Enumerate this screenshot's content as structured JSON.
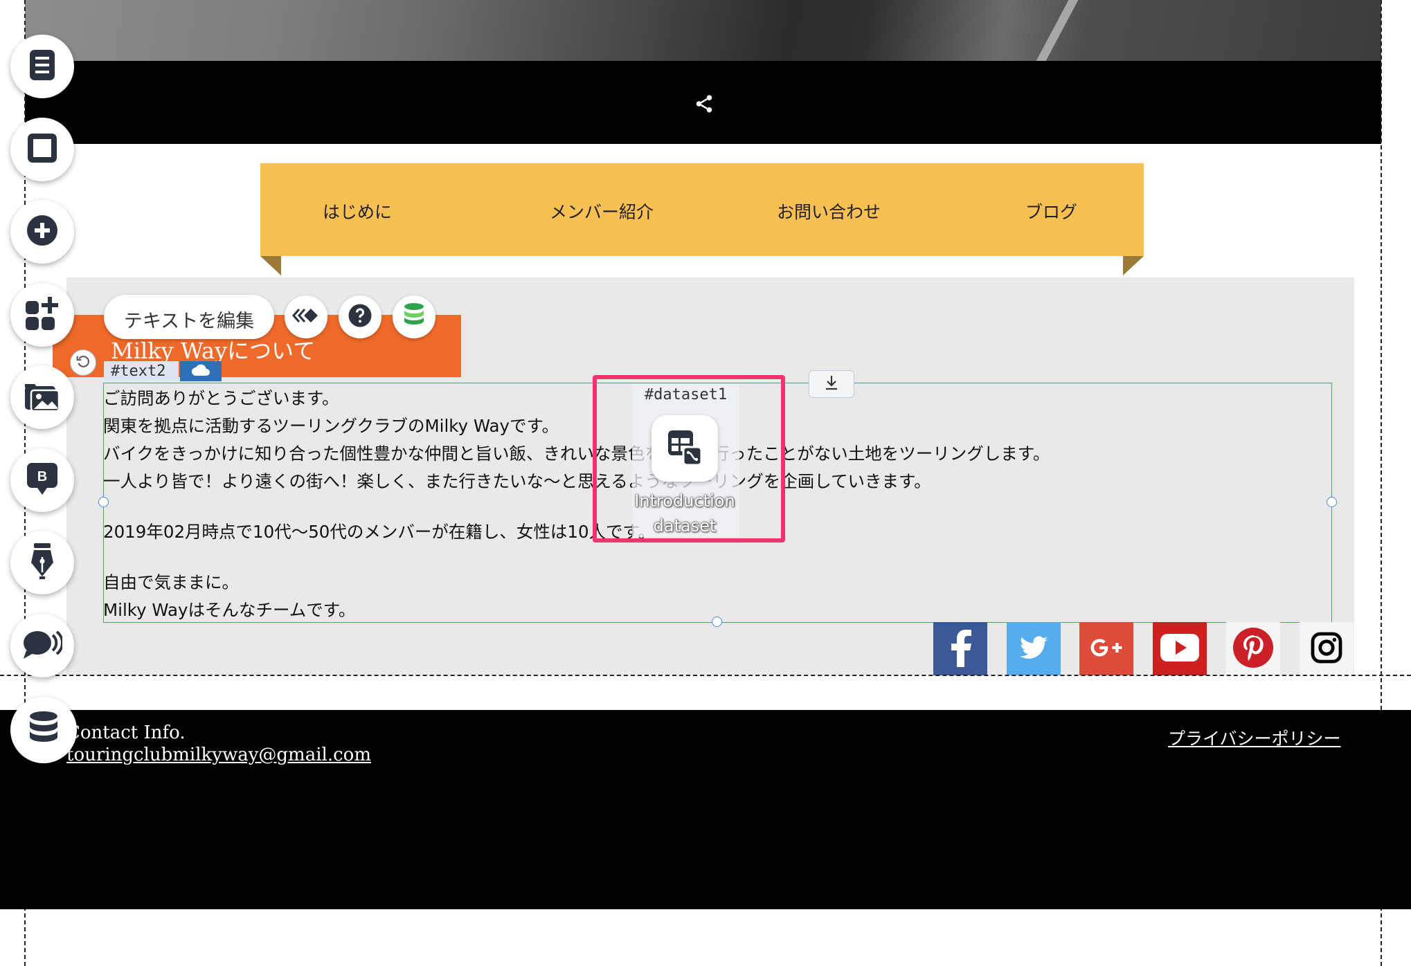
{
  "nav": {
    "items": [
      {
        "label": "はじめに"
      },
      {
        "label": "メンバー紹介"
      },
      {
        "label": "お問い合わせ"
      },
      {
        "label": "ブログ"
      }
    ]
  },
  "section": {
    "title": "Milky Wayについて"
  },
  "editor": {
    "edit_text_label": "テキストを編集",
    "element_tag": "#text2"
  },
  "body_text": {
    "paragraphs": [
      "ご訪問ありがとうございます。",
      "関東を拠点に活動するツーリングクラブのMilky Wayです。",
      "バイクをきっかけに知り合った個性豊かな仲間と旨い飯、きれいな景色を探して行ったことがない土地をツーリングします。",
      "一人より皆で！より遠くの街へ！楽しく、また行きたいな〜と思えるようなツーリングを企画していきます。",
      "2019年02月時点で10代〜50代のメンバーが在籍し、女性は10人です。",
      "自由で気ままに。",
      "Milky Wayはそんなチームです。"
    ]
  },
  "dataset": {
    "tag": "#dataset1",
    "name_line1": "Introduction",
    "name_line2": "dataset"
  },
  "social": [
    {
      "name": "facebook",
      "color": "#3b5998"
    },
    {
      "name": "twitter",
      "color": "#55acee"
    },
    {
      "name": "google-plus",
      "color": "#dd4b39"
    },
    {
      "name": "youtube",
      "color": "#cd201f"
    },
    {
      "name": "pinterest",
      "color": "#cb2027"
    },
    {
      "name": "instagram",
      "color": "#000000"
    }
  ],
  "footer": {
    "contact_heading": "Contact Info.",
    "email": "touringclubmilkyway@gmail.com",
    "privacy_link": "プライバシーポリシー"
  },
  "colors": {
    "nav_ribbon": "#f8bf52",
    "title_box": "#ef6a2a",
    "highlight": "#f5336f",
    "selection": "#4d8ee0"
  },
  "sidebar_tools": [
    "pages-icon",
    "section-icon",
    "add-icon",
    "apps-icon",
    "media-icon",
    "blog-icon",
    "design-pen-icon",
    "chat-icon",
    "database-icon"
  ]
}
